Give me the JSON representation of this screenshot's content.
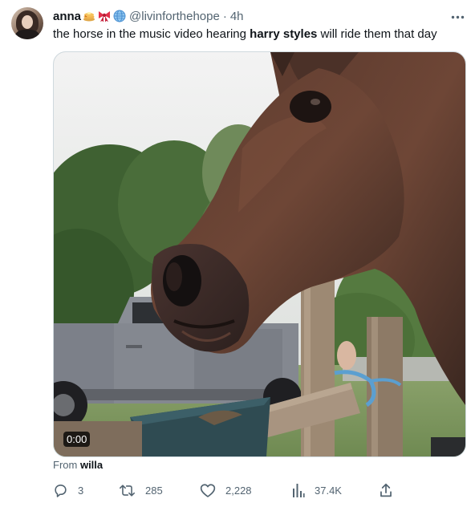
{
  "tweet": {
    "author": {
      "display_name": "anna",
      "handle": "@livinforthehope",
      "badges": [
        "pancakes-emoji",
        "ribbon-emoji",
        "globe-emoji"
      ]
    },
    "separator": "·",
    "time": "4h",
    "text": {
      "before": "the horse in the music video hearing ",
      "bold": "harry styles",
      "after": " will ride them that day"
    },
    "media": {
      "duration": "0:00",
      "source_prefix": "From ",
      "source_name": "willa"
    },
    "actions": {
      "replies": "3",
      "retweets": "285",
      "likes": "2,228",
      "views": "37.4K"
    }
  },
  "colors": {
    "text_primary": "#0f1419",
    "text_secondary": "#536471",
    "border": "#cfd9de"
  },
  "icons": {
    "more": "more-dots-icon",
    "reply": "reply-icon",
    "retweet": "retweet-icon",
    "like": "heart-icon",
    "views": "views-bar-icon",
    "share": "share-icon"
  }
}
